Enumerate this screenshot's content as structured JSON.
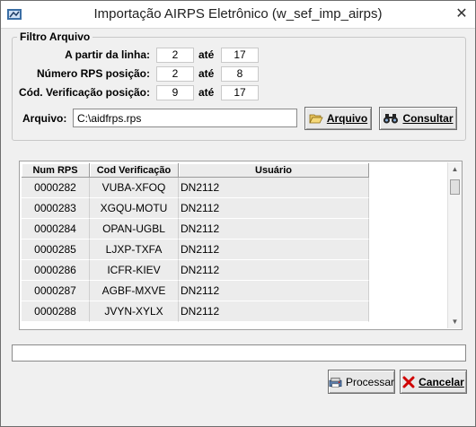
{
  "window": {
    "title": "Importação AIRPS Eletrônico (w_sef_imp_airps)",
    "close_glyph": "✕"
  },
  "filter": {
    "group_label": "Filtro Arquivo",
    "rows": [
      {
        "label": "A partir da linha:",
        "from": "2",
        "to_label": "até",
        "to": "17"
      },
      {
        "label": "Número RPS posição:",
        "from": "2",
        "to_label": "até",
        "to": "8"
      },
      {
        "label": "Cód. Verificação posição:",
        "from": "9",
        "to_label": "até",
        "to": "17"
      }
    ],
    "file_label": "Arquivo:",
    "file_value": "C:\\aidfrps.rps",
    "arquivo_button": "Arquivo",
    "consultar_button": "Consultar"
  },
  "grid": {
    "columns": [
      "Num RPS",
      "Cod Verificação",
      "Usuário"
    ],
    "rows": [
      [
        "0000282",
        "VUBA-XFOQ",
        "DN2112"
      ],
      [
        "0000283",
        "XGQU-MOTU",
        "DN2112"
      ],
      [
        "0000284",
        "OPAN-UGBL",
        "DN2112"
      ],
      [
        "0000285",
        "LJXP-TXFA",
        "DN2112"
      ],
      [
        "0000286",
        "ICFR-KIEV",
        "DN2112"
      ],
      [
        "0000287",
        "AGBF-MXVE",
        "DN2112"
      ],
      [
        "0000288",
        "JVYN-XYLX",
        "DN2112"
      ]
    ]
  },
  "status": {
    "value": ""
  },
  "buttons": {
    "processar": "Processar",
    "cancelar": "Cancelar"
  }
}
